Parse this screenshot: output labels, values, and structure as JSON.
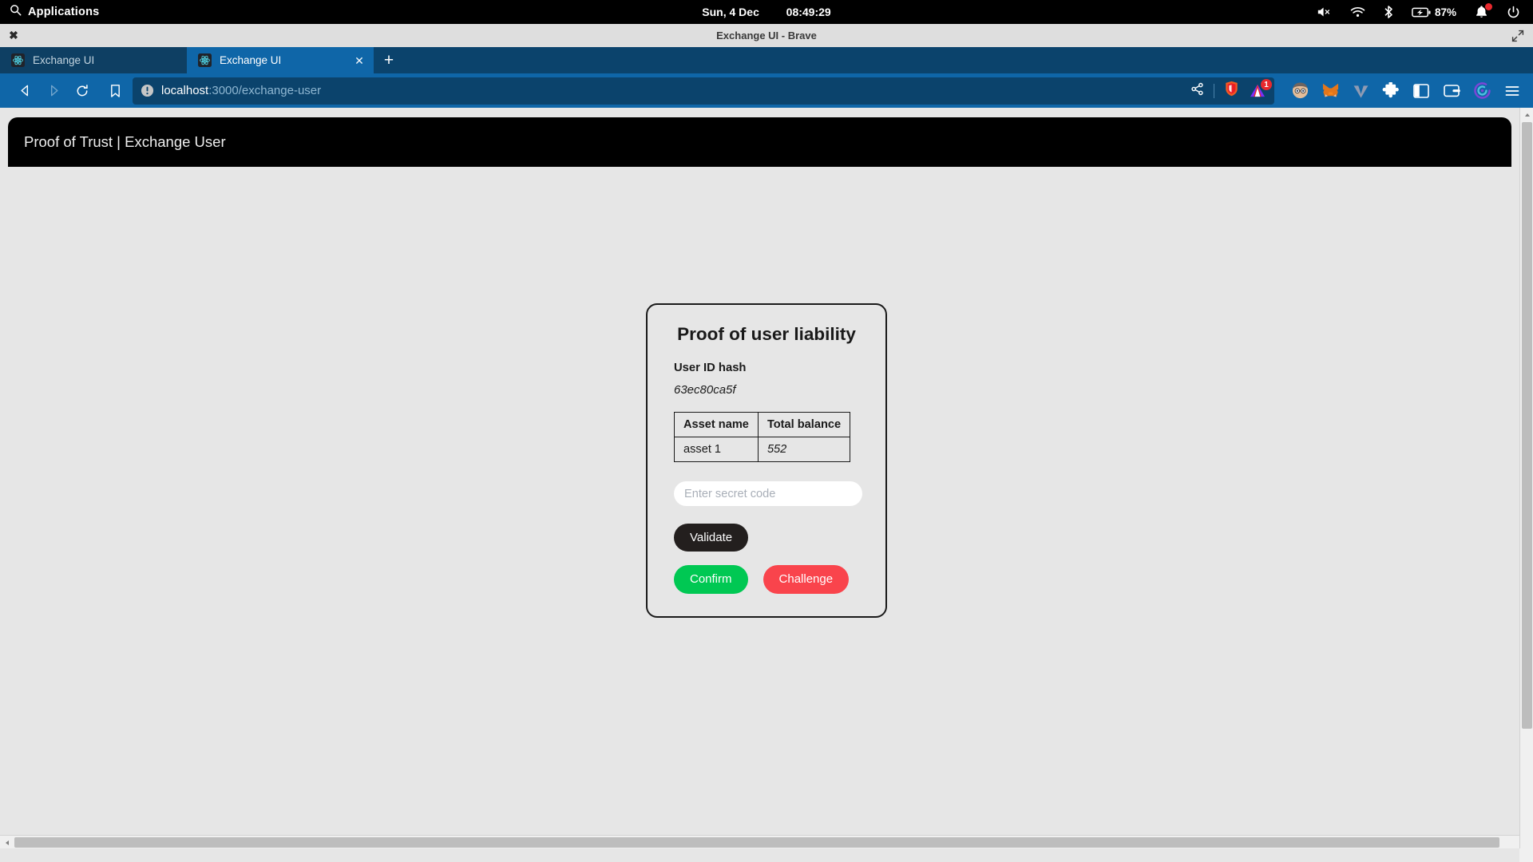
{
  "os_panel": {
    "search_icon": "search-icon",
    "applications_label": "Applications",
    "clock_date": "Sun,  4 Dec",
    "clock_time": "08:49:29",
    "tray": {
      "volume_icon": "volume-muted-icon",
      "wifi_icon": "wifi-icon",
      "bluetooth_icon": "bluetooth-icon",
      "battery_icon": "battery-charging-icon",
      "battery_percent": "87%",
      "notification_icon": "notification-bell-icon",
      "power_icon": "power-icon"
    }
  },
  "window": {
    "close_label": "✖",
    "title": "Exchange UI - Brave",
    "maximize_icon": "maximize-icon"
  },
  "tabs": [
    {
      "favicon": "react-favicon",
      "label": "Exchange UI",
      "active": false
    },
    {
      "favicon": "react-favicon",
      "label": "Exchange UI",
      "active": true,
      "close_label": "✕"
    }
  ],
  "new_tab_label": "+",
  "toolbar": {
    "back_icon": "back-arrow-icon",
    "forward_icon": "forward-arrow-icon",
    "reload_icon": "reload-icon",
    "bookmark_icon": "bookmark-icon",
    "security_icon": "not-secure-info-icon",
    "url_host": "localhost",
    "url_path": ":3000/exchange-user",
    "url_full": "localhost:3000/exchange-user",
    "share_icon": "share-icon",
    "brave_shield_icon": "brave-shields-icon",
    "extension_alert_icon": "extension-alert-icon",
    "extension_alert_badge": "1",
    "extensions": [
      {
        "icon": "profile-avatar-extension-icon"
      },
      {
        "icon": "metamask-fox-icon"
      },
      {
        "icon": "vee-wallet-icon"
      },
      {
        "icon": "extensions-puzzle-icon"
      },
      {
        "icon": "sidebar-panel-icon"
      },
      {
        "icon": "brave-wallet-icon"
      },
      {
        "icon": "brave-leo-icon"
      },
      {
        "icon": "hamburger-menu-icon"
      }
    ]
  },
  "page": {
    "header_title": "Proof of Trust | Exchange User",
    "card": {
      "title": "Proof of user liability",
      "user_id_label": "User ID hash",
      "user_id_value": "63ec80ca5f",
      "table": {
        "headers": [
          "Asset name",
          "Total balance"
        ],
        "rows": [
          {
            "asset": "asset 1",
            "balance": "552"
          }
        ]
      },
      "secret_input_placeholder": "Enter secret code",
      "secret_input_value": "",
      "validate_label": "Validate",
      "confirm_label": "Confirm",
      "challenge_label": "Challenge"
    }
  },
  "colors": {
    "os_panel_bg": "#000000",
    "browser_chrome": "#0f66a8",
    "tab_inactive": "#0e3f63",
    "page_bg": "#e6e6e6",
    "app_header_bg": "#000000",
    "validate": "#231f1e",
    "confirm": "#00c853",
    "challenge": "#f9444c",
    "badge_red": "#e8292e"
  }
}
